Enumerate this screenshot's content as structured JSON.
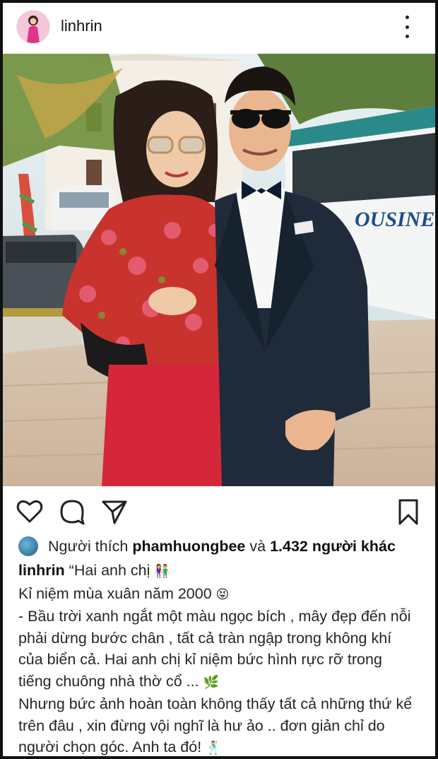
{
  "post": {
    "username": "linhrin",
    "icons": {
      "more": "more-vertical-icon",
      "like": "heart-icon",
      "comment": "comment-icon",
      "share": "send-icon",
      "save": "bookmark-icon"
    }
  },
  "likes": {
    "prefix": "Người thích",
    "user": "phamhuongbee",
    "connector": "và",
    "count_text": "1.432 người khác"
  },
  "caption": {
    "author": "linhrin",
    "first_text": "“Hai anh chị",
    "first_emoji": "👫",
    "line2_text": "Kỉ niệm mùa xuân năm 2000",
    "line2_emoji": "😝",
    "line3": "- Bầu trời xanh ngắt một màu ngọc bích , mây đẹp đến nỗi",
    "line4": "phải dừng bước chân , tất cả tràn ngập trong không khí",
    "line5": "của biển cả. Hai anh chị kỉ niệm bức hình rực rỡ trong",
    "line6_text": "tiếng chuông nhà thờ cổ ...",
    "line6_emoji": "🌿",
    "line7": "Nhưng bức ảnh hoàn toàn không thấy tất cả những thứ kể",
    "line8": "trên đâu , xin đừng vội nghĩ là hư ảo .. đơn giản chỉ do",
    "line9_text": "người chọn góc. Anh ta đó!",
    "line9_emoji": "🕺"
  },
  "bus_sign_text": "OUSINE",
  "colors": {
    "background": "#ffffff",
    "border": "#111111",
    "text": "#262626"
  }
}
